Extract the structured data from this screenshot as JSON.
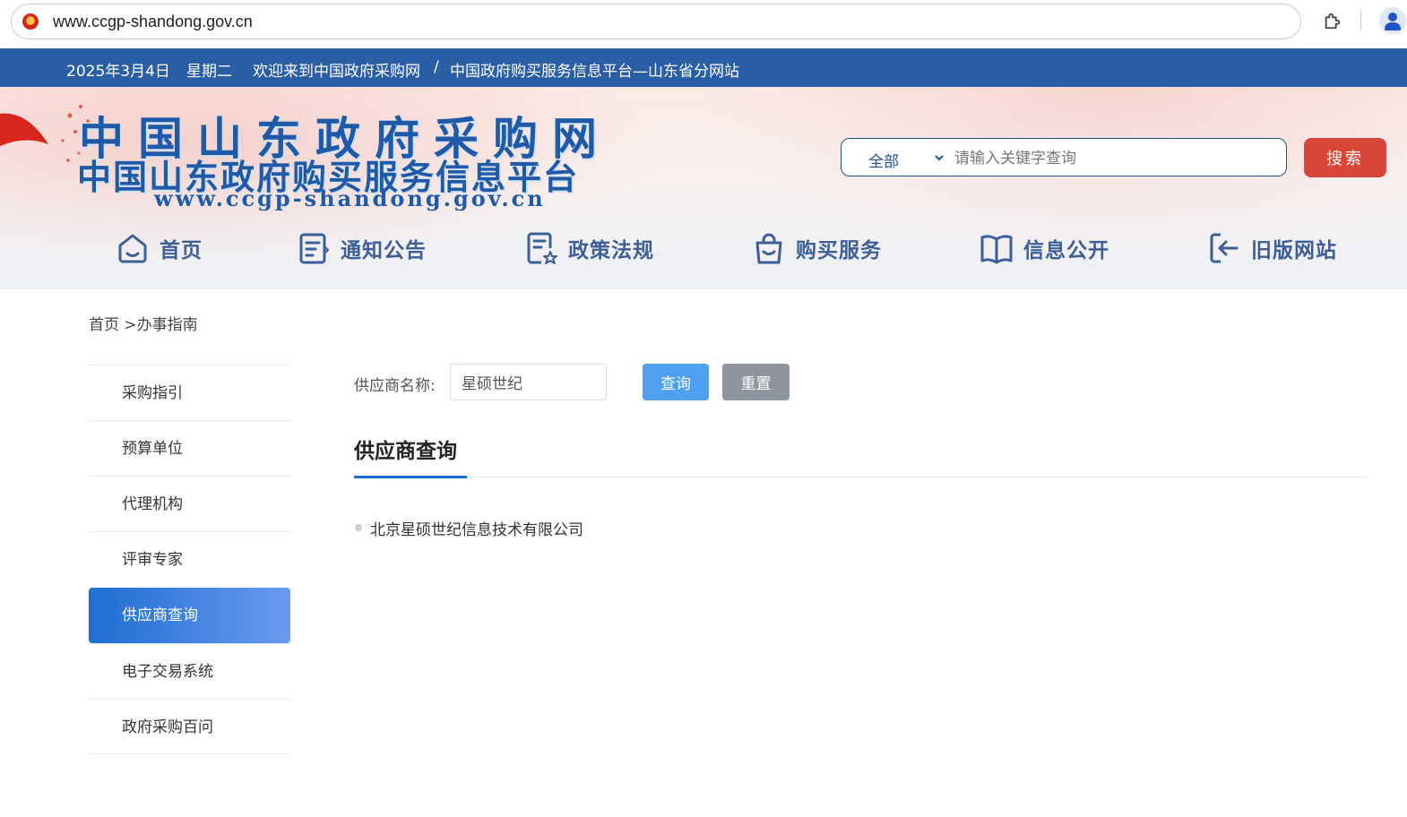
{
  "browser": {
    "url": "www.ccgp-shandong.gov.cn"
  },
  "topbar": {
    "date": "2025年3月4日",
    "weekday": "星期二",
    "welcome": "欢迎来到中国政府采购网",
    "separator": "/",
    "platform": "中国政府购买服务信息平台—山东省分网站"
  },
  "logo": {
    "line1": "中国山东政府采购网",
    "line2": "中国山东政府购买服务信息平台",
    "line3": "www.ccgp-shandong.gov.cn"
  },
  "search": {
    "category": "全部",
    "placeholder": "请输入关键字查询",
    "button": "搜索"
  },
  "nav": [
    {
      "label": "首页",
      "icon": "home-icon"
    },
    {
      "label": "通知公告",
      "icon": "notice-icon"
    },
    {
      "label": "政策法规",
      "icon": "policy-icon"
    },
    {
      "label": "购买服务",
      "icon": "shopping-bag-icon"
    },
    {
      "label": "信息公开",
      "icon": "open-book-icon"
    },
    {
      "label": "旧版网站",
      "icon": "exit-icon"
    }
  ],
  "breadcrumb": {
    "home": "首页",
    "current": " >办事指南"
  },
  "sidebar": {
    "items": [
      {
        "label": "采购指引",
        "active": false
      },
      {
        "label": "预算单位",
        "active": false
      },
      {
        "label": "代理机构",
        "active": false
      },
      {
        "label": "评审专家",
        "active": false
      },
      {
        "label": "供应商查询",
        "active": true
      },
      {
        "label": "电子交易系统",
        "active": false
      },
      {
        "label": "政府采购百问",
        "active": false
      }
    ]
  },
  "filter": {
    "label": "供应商名称:",
    "value": "星硕世纪",
    "query_button": "查询",
    "reset_button": "重置"
  },
  "section": {
    "title": "供应商查询"
  },
  "results": [
    "北京星硕世纪信息技术有限公司"
  ],
  "colors": {
    "topbar": "#2a5ea5",
    "brand_blue": "#1e5aa8",
    "search_button": "#d9463a",
    "active_sidebar": "#1e6ed1",
    "query_button": "#4f9ff2",
    "reset_button": "#8f959e"
  }
}
